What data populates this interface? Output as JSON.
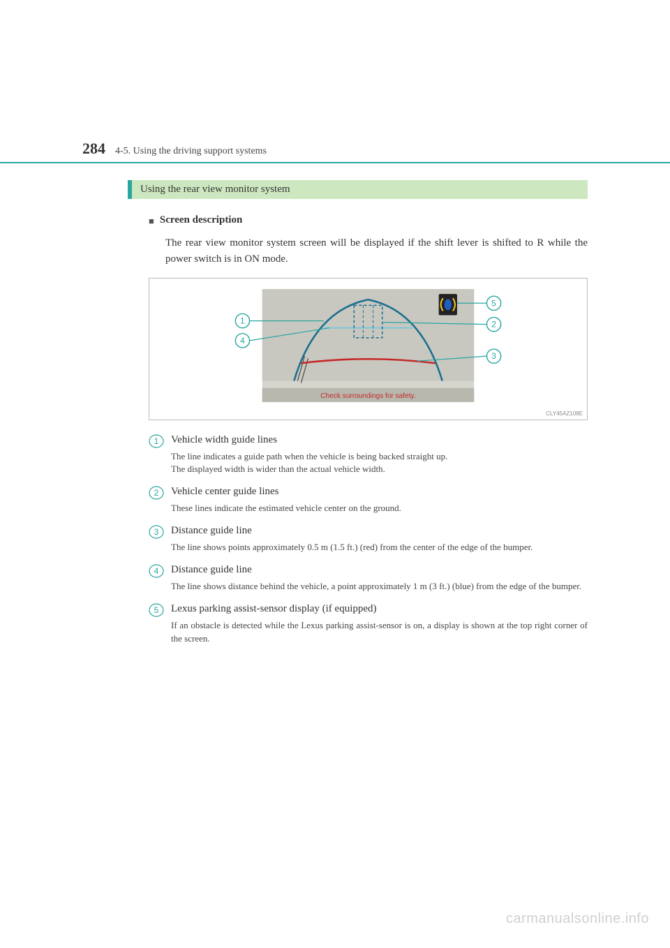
{
  "header": {
    "page_number": "284",
    "section_path": "4-5. Using the driving support systems"
  },
  "heading": "Using the rear view monitor system",
  "subheading": "Screen description",
  "intro": "The rear view monitor system screen will be displayed if the shift lever is shifted to R while the power switch is in ON mode.",
  "figure": {
    "safety_text": "Check surroundings for safety.",
    "image_code": "CLY45AZ108E",
    "callouts": [
      "1",
      "2",
      "3",
      "4",
      "5"
    ]
  },
  "items": [
    {
      "num": "1",
      "title": "Vehicle width guide lines",
      "desc1": "The line indicates a guide path when the vehicle is being backed straight up.",
      "desc2": "The displayed width is wider than the actual vehicle width."
    },
    {
      "num": "2",
      "title": "Vehicle center guide lines",
      "desc1": "These lines indicate the estimated vehicle center on the ground."
    },
    {
      "num": "3",
      "title": "Distance guide line",
      "desc1": "The line shows points approximately 0.5 m (1.5 ft.) (red) from the center of the edge of the bumper."
    },
    {
      "num": "4",
      "title": "Distance guide line",
      "desc1": "The line shows distance behind the vehicle, a point approximately 1 m (3 ft.) (blue) from the edge of the bumper."
    },
    {
      "num": "5",
      "title": "Lexus parking assist-sensor display (if equipped)",
      "desc1": "If an obstacle is detected while the Lexus parking assist-sensor is on, a display is shown at the top right corner of the screen."
    }
  ],
  "watermark": "carmanualsonline.info"
}
